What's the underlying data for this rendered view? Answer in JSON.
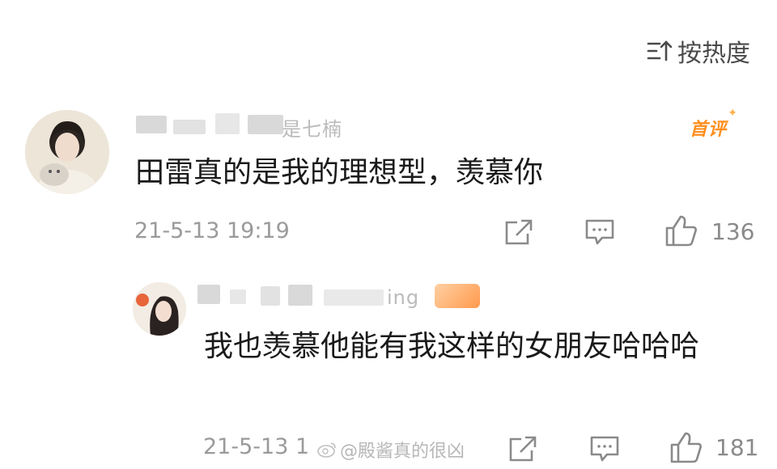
{
  "sort": {
    "label": "按热度"
  },
  "comments": [
    {
      "username": "是七楠",
      "badge": "首评",
      "text": "田雷真的是我的理想型，羡慕你",
      "timestamp": "21-5-13 19:19",
      "likes": "136"
    }
  ],
  "reply": {
    "username": "ing",
    "text": "我也羡慕他能有我这样的女朋友哈哈哈",
    "timestamp": "21-5-13 1",
    "likes": "181"
  },
  "watermark": "@殿酱真的很凶",
  "icons": [
    "sort-icon",
    "repost-icon",
    "comment-icon",
    "like-icon"
  ]
}
